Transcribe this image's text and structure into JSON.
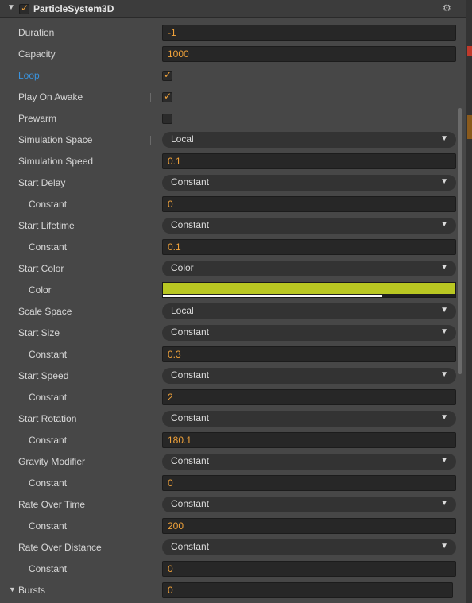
{
  "component": {
    "title": "ParticleSystem3D",
    "enabled": true
  },
  "colors": {
    "start_color": "#b9c722",
    "accent": "#f0a23a",
    "link": "#3a93dd"
  },
  "icons": {
    "gear": "gear-icon",
    "collapse": "triangle-down-icon",
    "checkmark": "checkmark-icon",
    "dropdown": "chevron-down-icon"
  },
  "props": {
    "duration": {
      "label": "Duration",
      "value": "-1"
    },
    "capacity": {
      "label": "Capacity",
      "value": "1000"
    },
    "loop": {
      "label": "Loop",
      "checked": true
    },
    "play_on_awake": {
      "label": "Play On Awake",
      "checked": true
    },
    "prewarm": {
      "label": "Prewarm",
      "checked": false
    },
    "simulation_space": {
      "label": "Simulation Space",
      "value": "Local"
    },
    "simulation_speed": {
      "label": "Simulation Speed",
      "value": "0.1"
    },
    "start_delay": {
      "label": "Start Delay",
      "mode": "Constant",
      "sub_label": "Constant",
      "value": "0"
    },
    "start_lifetime": {
      "label": "Start Lifetime",
      "mode": "Constant",
      "sub_label": "Constant",
      "value": "0.1"
    },
    "start_color": {
      "label": "Start Color",
      "mode": "Color",
      "sub_label": "Color"
    },
    "scale_space": {
      "label": "Scale Space",
      "value": "Local"
    },
    "start_size": {
      "label": "Start Size",
      "mode": "Constant",
      "sub_label": "Constant",
      "value": "0.3"
    },
    "start_speed": {
      "label": "Start Speed",
      "mode": "Constant",
      "sub_label": "Constant",
      "value": "2"
    },
    "start_rotation": {
      "label": "Start Rotation",
      "mode": "Constant",
      "sub_label": "Constant",
      "value": "180.1"
    },
    "gravity_modifier": {
      "label": "Gravity Modifier",
      "mode": "Constant",
      "sub_label": "Constant",
      "value": "0"
    },
    "rate_over_time": {
      "label": "Rate Over Time",
      "mode": "Constant",
      "sub_label": "Constant",
      "value": "200"
    },
    "rate_over_distance": {
      "label": "Rate Over Distance",
      "mode": "Constant",
      "sub_label": "Constant",
      "value": "0"
    },
    "bursts": {
      "label": "Bursts",
      "value": "0"
    }
  }
}
